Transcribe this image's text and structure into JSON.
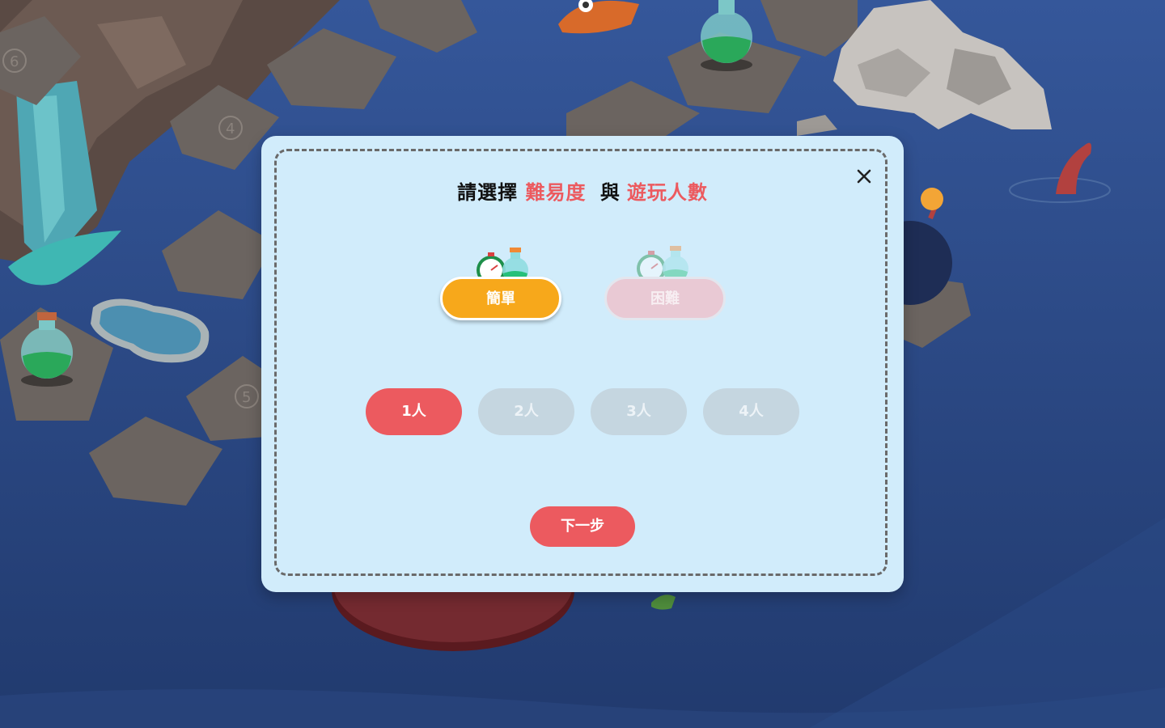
{
  "dialog": {
    "title_part1": "請選擇",
    "title_highlight1": "難易度",
    "title_part2": "與",
    "title_highlight2": "遊玩人數",
    "close_icon": "close-icon"
  },
  "difficulty": {
    "selected": "簡單",
    "options": [
      {
        "label": "簡單",
        "state": "selected",
        "icon": "stopwatch-and-potion-icon"
      },
      {
        "label": "困難",
        "state": "unselected",
        "icon": "stopwatch-and-potion-icon"
      }
    ]
  },
  "players": {
    "selected": "1人",
    "options": [
      {
        "label": "1人",
        "state": "selected"
      },
      {
        "label": "2人",
        "state": "unselected"
      },
      {
        "label": "3人",
        "state": "unselected"
      },
      {
        "label": "4人",
        "state": "unselected"
      }
    ]
  },
  "next_button": {
    "label": "下一步"
  },
  "colors": {
    "accent_red": "#ec5a5f",
    "easy_orange": "#f7a81b",
    "modal_bg": "#d1ecfb",
    "inactive_gray": "#c5d6e0",
    "sea_blue": "#2f4f8a"
  },
  "background": {
    "icons": [
      "potion-bottle-icon",
      "stone-tile-icon",
      "rock-pile-icon",
      "tentacle-icon",
      "bomb-icon",
      "fish-icon",
      "waterfall-icon",
      "pond-icon"
    ],
    "tile_numbers": [
      "6",
      "4",
      "5"
    ]
  }
}
